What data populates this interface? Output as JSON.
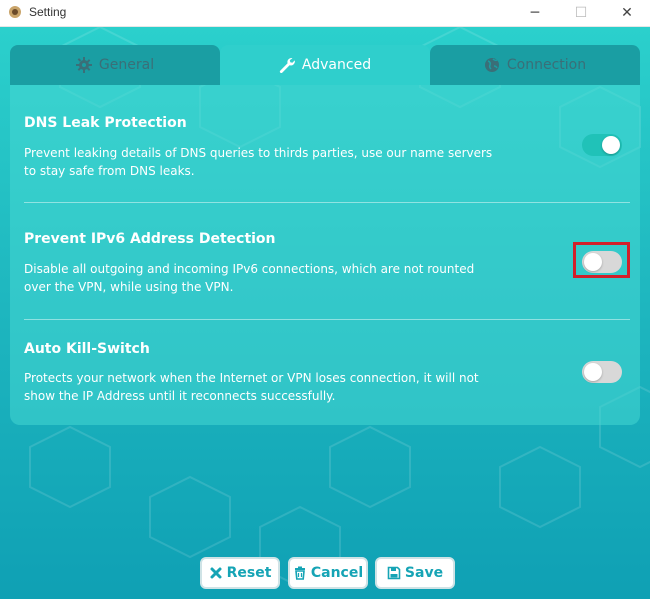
{
  "window": {
    "title": "Setting",
    "minimize": "─",
    "maximize": "☐",
    "close": "✕"
  },
  "tabs": [
    {
      "label": "General",
      "icon": "gear-icon",
      "active": false
    },
    {
      "label": "Advanced",
      "icon": "wrench-icon",
      "active": true
    },
    {
      "label": "Connection",
      "icon": "globe-icon",
      "active": false
    }
  ],
  "settings": [
    {
      "title": "DNS Leak Protection",
      "description": "Prevent leaking details of DNS queries to thirds parties, use our name servers to stay safe from DNS leaks.",
      "enabled": true
    },
    {
      "title": "Prevent IPv6 Address Detection",
      "description": "Disable all outgoing and incoming IPv6 connections, which are not rounted over the VPN, while using the VPN.",
      "enabled": false
    },
    {
      "title": "Auto Kill-Switch",
      "description": "Protects your network when the Internet or VPN loses connection, it will not show the IP Address until it reconnects successfully.",
      "enabled": false
    }
  ],
  "buttons": {
    "reset": "Reset",
    "cancel": "Cancel",
    "save": "Save"
  },
  "colors": {
    "accent": "#16a4b5",
    "background_top": "#2bd0cc",
    "background_bottom": "#0fa0b4",
    "highlight": "#d21f2a",
    "toggle_on": "#20c2b8",
    "toggle_off": "#d8d8d8"
  }
}
